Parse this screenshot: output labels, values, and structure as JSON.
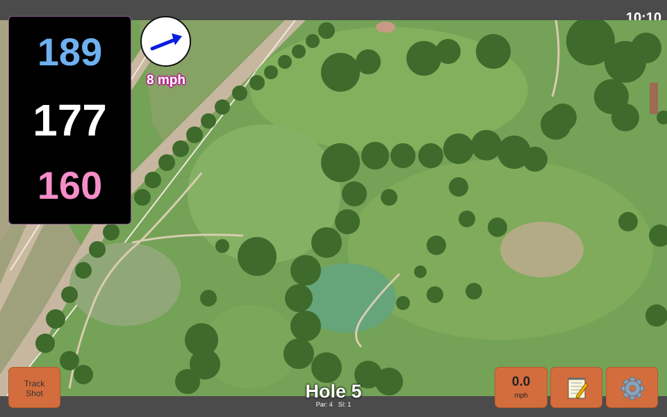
{
  "status_bar": {
    "time": "10:10"
  },
  "distances": {
    "back": "189",
    "middle": "177",
    "front": "160"
  },
  "wind": {
    "speed": "8 mph"
  },
  "hole": {
    "title": "Hole 5",
    "par": "Par: 4",
    "si": "SI: 1"
  },
  "controls": {
    "track_shot_line1": "Track",
    "track_shot_line2": "Shot",
    "speed_value": "0.0",
    "speed_unit": "mph",
    "notes_icon": "notepad-icon",
    "settings_icon": "gear-icon"
  },
  "colors": {
    "back": "#6eb1f0",
    "middle": "#ffffff",
    "front": "#f58ec8",
    "button": "#d36d3d",
    "wind_arrow": "#0a1ee0"
  }
}
